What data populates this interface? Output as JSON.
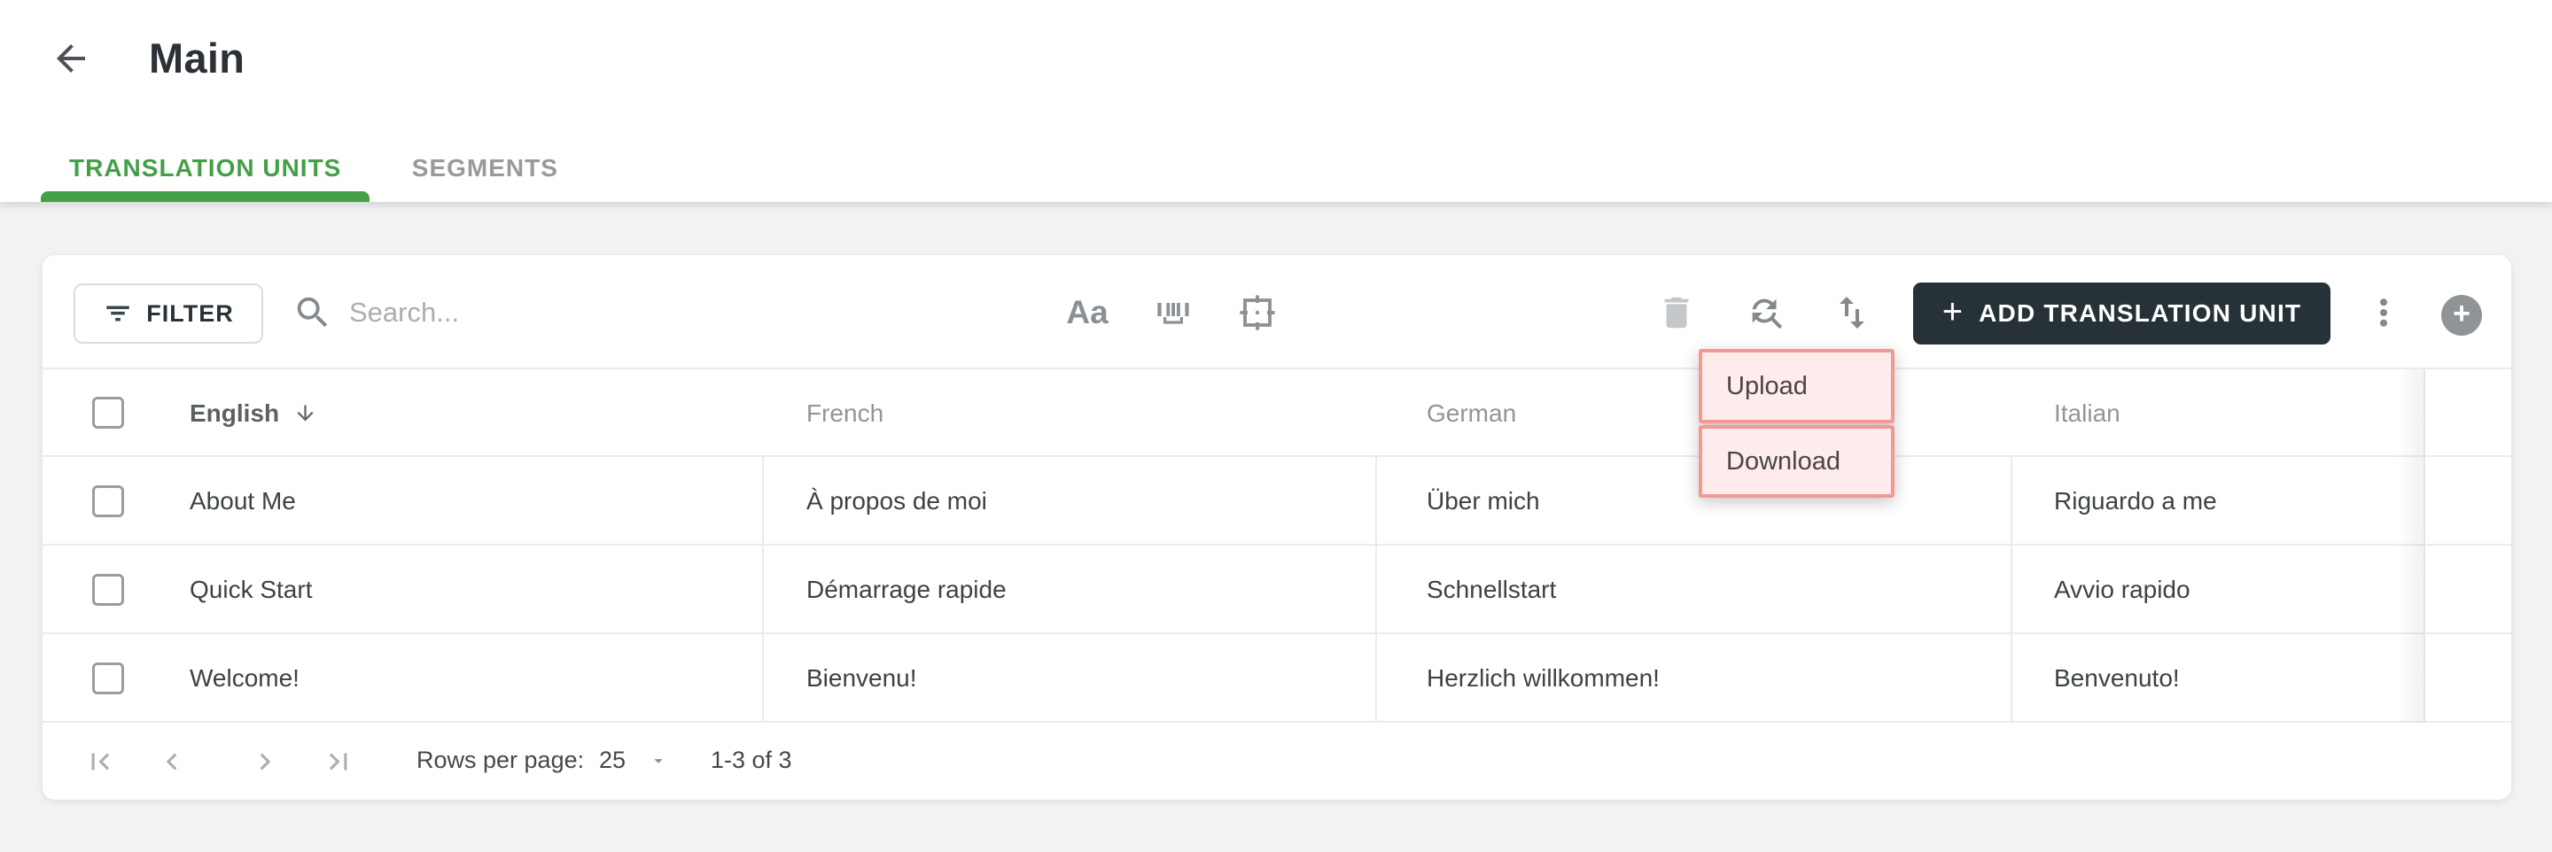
{
  "page": {
    "title": "Main",
    "tabs": [
      {
        "label": "TRANSLATION UNITS",
        "active": true
      },
      {
        "label": "SEGMENTS",
        "active": false
      }
    ]
  },
  "toolbar": {
    "filter_label": "FILTER",
    "search_placeholder": "Search...",
    "match_case_label": "Aa",
    "add_button_plus": "+",
    "add_button_label": "ADD TRANSLATION UNIT",
    "fab_plus": "+"
  },
  "menu": {
    "items": [
      {
        "label": "Upload"
      },
      {
        "label": "Download"
      }
    ]
  },
  "table": {
    "columns": [
      "English",
      "French",
      "German",
      "Italian"
    ],
    "sorted_column": "English",
    "sort_direction": "descending-arrow-down",
    "rows": [
      [
        "About Me",
        "À propos de moi",
        "Über mich",
        "Riguardo a me"
      ],
      [
        "Quick Start",
        "Démarrage rapide",
        "Schnellstart",
        "Avvio rapido"
      ],
      [
        "Welcome!",
        "Bienvenu!",
        "Herzlich willkommen!",
        "Benvenuto!"
      ]
    ]
  },
  "footer": {
    "rows_per_page_label": "Rows per page:",
    "rows_per_page_value": "25",
    "range": "1-3 of 3"
  },
  "colors": {
    "accent_green": "#43a047",
    "dark_button": "#263238",
    "highlight_fill": "#fdeceb",
    "highlight_border": "#f49892",
    "page_background": "#f1f2f4",
    "card_background": "#ffffff"
  }
}
